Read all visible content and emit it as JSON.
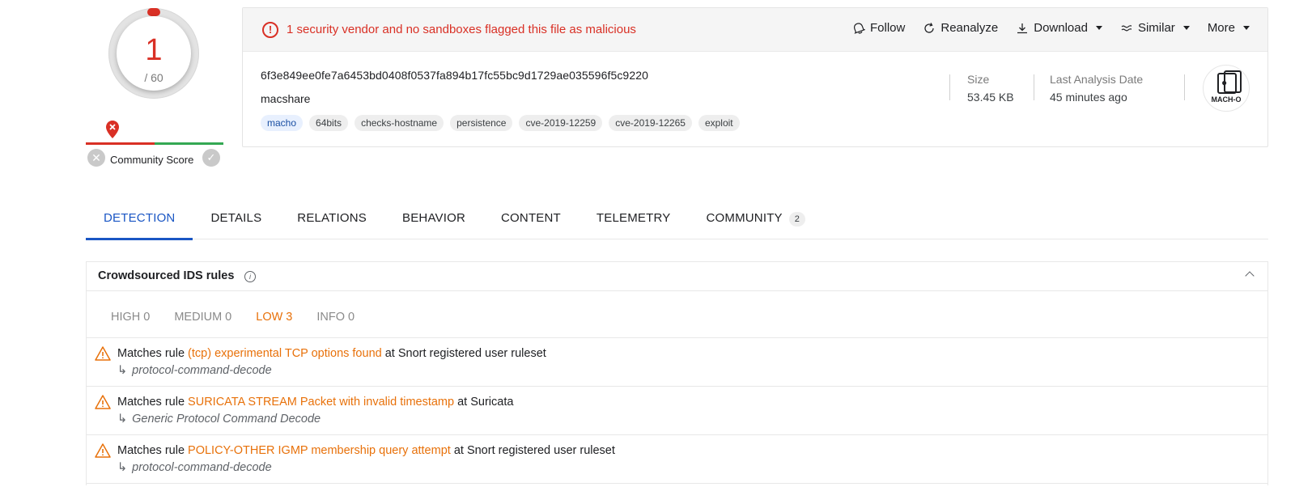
{
  "score": {
    "detections": "1",
    "total": "/ 60",
    "community_label": "Community Score"
  },
  "alert": {
    "text": "1 security vendor and no sandboxes flagged this file as malicious"
  },
  "actions": {
    "follow": "Follow",
    "reanalyze": "Reanalyze",
    "download": "Download",
    "similar": "Similar",
    "more": "More"
  },
  "file": {
    "hash": "6f3e849ee0fe7a6453bd0408f0537fa894b17fc55bc9d1729ae035596f5c9220",
    "name": "macshare",
    "tags": [
      "macho",
      "64bits",
      "checks-hostname",
      "persistence",
      "cve-2019-12259",
      "cve-2019-12265",
      "exploit"
    ],
    "size_label": "Size",
    "size_value": "53.45 KB",
    "date_label": "Last Analysis Date",
    "date_value": "45 minutes ago",
    "type_label": "MACH-O"
  },
  "tabs": [
    "DETECTION",
    "DETAILS",
    "RELATIONS",
    "BEHAVIOR",
    "CONTENT",
    "TELEMETRY",
    "COMMUNITY"
  ],
  "community_count": "2",
  "ids": {
    "title": "Crowdsourced IDS rules",
    "severity": [
      "HIGH 0",
      "MEDIUM 0",
      "LOW 3",
      "INFO 0"
    ],
    "rules": [
      {
        "prefix": "Matches rule ",
        "rule": "(tcp) experimental TCP options found",
        "suffix": " at Snort registered user ruleset",
        "category": "protocol-command-decode"
      },
      {
        "prefix": "Matches rule ",
        "rule": "SURICATA STREAM Packet with invalid timestamp",
        "suffix": " at Suricata",
        "category": "Generic Protocol Command Decode"
      },
      {
        "prefix": "Matches rule ",
        "rule": "POLICY-OTHER IGMP membership query attempt",
        "suffix": " at Snort registered user ruleset",
        "category": "protocol-command-decode"
      }
    ]
  },
  "colors": {
    "malicious": "#d93025",
    "accent": "#1a56c4",
    "low": "#e8710a"
  }
}
